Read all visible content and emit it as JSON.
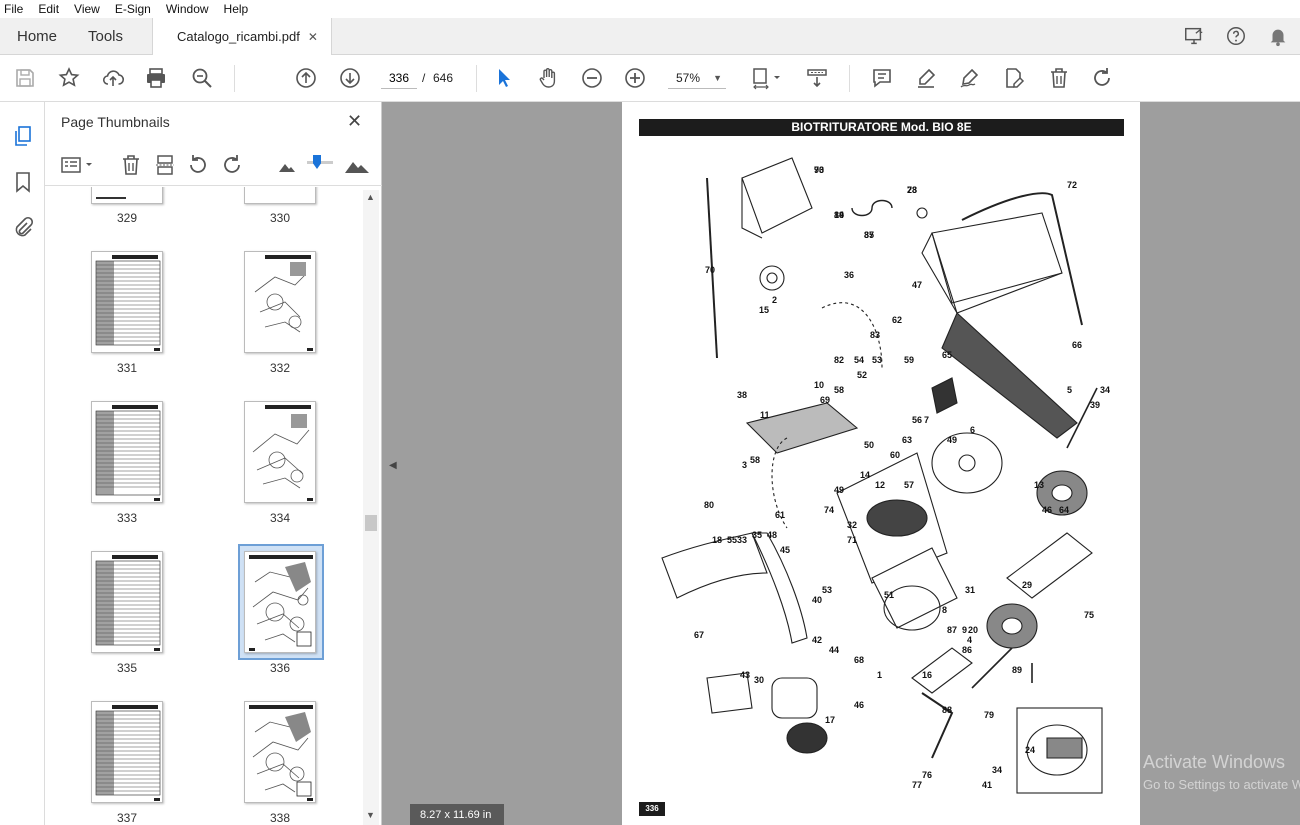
{
  "menu": [
    "File",
    "Edit",
    "View",
    "E-Sign",
    "Window",
    "Help"
  ],
  "tabs": {
    "home": "Home",
    "tools": "Tools",
    "document": "Catalogo_ricambi.pdf",
    "close_glyph": "✕"
  },
  "toolbar": {
    "current_page": "336",
    "page_separator": "/",
    "total_pages": "646",
    "zoom": "57%"
  },
  "panel": {
    "title": "Page Thumbnails",
    "thumbnails": [
      {
        "label": "329"
      },
      {
        "label": "330"
      },
      {
        "label": "331"
      },
      {
        "label": "332"
      },
      {
        "label": "333"
      },
      {
        "label": "334"
      },
      {
        "label": "335"
      },
      {
        "label": "336",
        "selected": true
      },
      {
        "label": "337"
      },
      {
        "label": "338"
      }
    ]
  },
  "document": {
    "header": "BIOTRITURATORE Mod. BIO 8E",
    "page_number": "336",
    "page_size": "8.27 x 11.69 in",
    "part_numbers": [
      "73",
      "84",
      "85",
      "23",
      "72",
      "47",
      "70",
      "15",
      "2",
      "36",
      "66",
      "83",
      "53",
      "62",
      "54",
      "82",
      "59",
      "65",
      "5",
      "39",
      "34",
      "38",
      "11",
      "69",
      "10",
      "58",
      "52",
      "56",
      "7",
      "6",
      "3",
      "49",
      "63",
      "60",
      "50",
      "14",
      "58",
      "49",
      "74",
      "61",
      "80",
      "12",
      "57",
      "13",
      "46",
      "64",
      "18",
      "33",
      "35",
      "48",
      "32",
      "71",
      "55",
      "45",
      "29",
      "31",
      "53",
      "51",
      "8",
      "87",
      "9",
      "4",
      "40",
      "42",
      "44",
      "67",
      "43",
      "30",
      "68",
      "20",
      "1",
      "16",
      "86",
      "75",
      "46",
      "17",
      "88",
      "89",
      "79",
      "24",
      "41",
      "76",
      "34",
      "77",
      "90",
      "19",
      "37",
      "78"
    ]
  },
  "watermark": {
    "line1": "Activate Windows",
    "line2": "Go to Settings to activate Windows."
  }
}
